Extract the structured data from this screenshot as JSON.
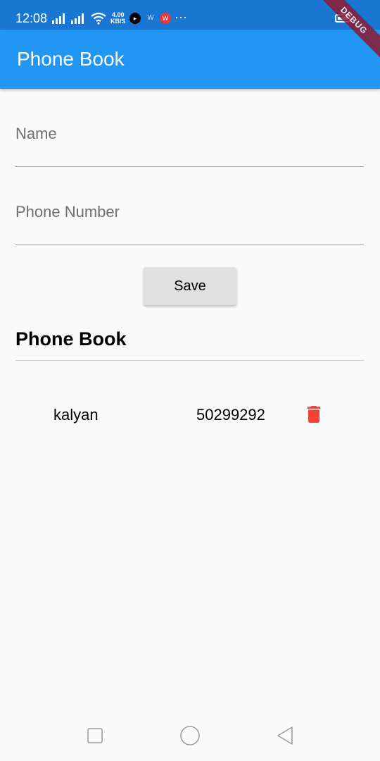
{
  "status_bar": {
    "time": "12:08",
    "net_speed_value": "4.00",
    "net_speed_unit": "KB/S",
    "more": "···",
    "icons": [
      "signal-icon",
      "signal-icon",
      "wifi-icon",
      "play-app-icon",
      "app-icon",
      "wps-icon",
      "battery-icon"
    ]
  },
  "debug_banner": "DEBUG",
  "app_bar": {
    "title": "Phone Book"
  },
  "form": {
    "name_placeholder": "Name",
    "name_value": "",
    "phone_placeholder": "Phone Number",
    "phone_value": "",
    "save_label": "Save"
  },
  "list": {
    "title": "Phone Book",
    "contacts": [
      {
        "name": "kalyan",
        "number": "50299292"
      }
    ]
  },
  "colors": {
    "status_bar": "#1976d2",
    "app_bar": "#2196f3",
    "delete": "#f44336",
    "button": "#e0e0e0",
    "background": "#fafafa"
  }
}
